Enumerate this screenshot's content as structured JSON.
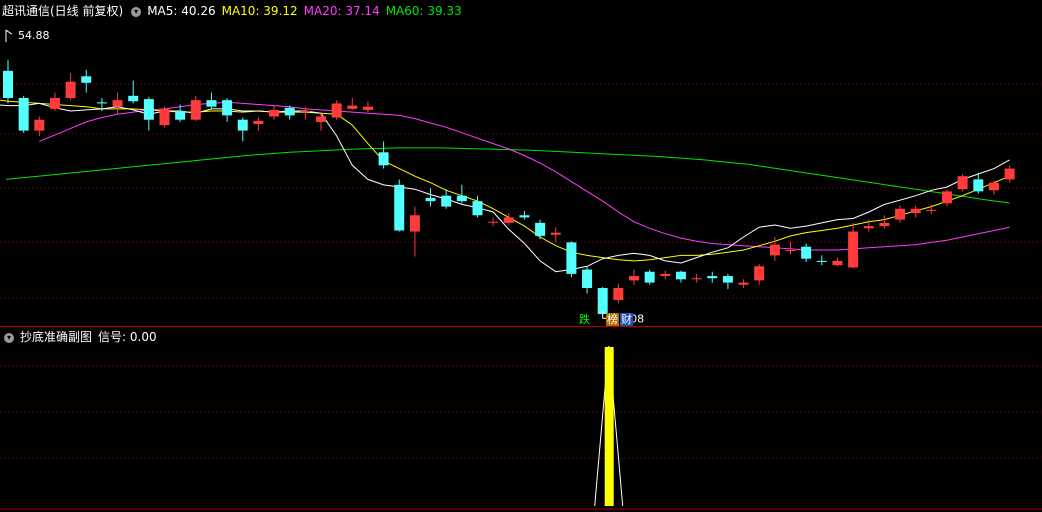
{
  "main_panel": {
    "title": "超讯通信(日线 前复权)",
    "ma_labels": [
      {
        "text": "MA5: 40.26",
        "color": "#ffffff"
      },
      {
        "text": "MA10: 39.12",
        "color": "#ffff00"
      },
      {
        "text": "MA20: 37.14",
        "color": "#ff3cff"
      },
      {
        "text": "MA60: 39.33",
        "color": "#00e600"
      }
    ],
    "high_label": "54.88",
    "low_label": "29.08",
    "tags": [
      {
        "text": "跌",
        "color": "#00ff00",
        "bg": "#000000"
      },
      {
        "text": "榜",
        "color": "#ffffff",
        "bg": "#b36b00"
      },
      {
        "text": "财",
        "color": "#ffffff",
        "bg": "#1f4fb0"
      }
    ]
  },
  "sub_panel": {
    "title": "抄底准确副图",
    "signal_label": "信号: 0.00"
  },
  "colors": {
    "up": "#ff3b3b",
    "down": "#54ffff",
    "ma5": "#ffffff",
    "ma10": "#ffff00",
    "ma20": "#ff3cff",
    "ma60": "#00e600",
    "signal": "#ffff00",
    "grid": "#8b0000"
  },
  "chart_data": [
    {
      "type": "candlestick",
      "ylim": [
        28,
        56
      ],
      "series": [
        {
          "name": "MA5",
          "values": [
            50,
            48.8,
            48.5,
            48.4,
            48.3,
            48.3,
            48.5,
            48.1,
            47.8,
            47.9,
            48.0,
            48.2,
            47.9,
            47.5,
            47.8,
            47.8,
            47.6,
            48.0,
            48.0,
            47.8,
            47.8,
            47.7,
            47.8,
            47.8,
            47.6,
            45.5,
            42.8,
            41.5,
            41.0,
            40.8,
            40.6,
            40.1,
            39.7,
            39.2,
            38.9,
            38.5,
            36.9,
            35.6,
            34.0,
            33.0,
            33.2,
            33.5,
            34.2,
            34.5,
            34.7,
            34.5,
            34.0,
            33.8,
            34.3,
            34.8,
            35.2,
            36.2,
            37.1,
            37.3,
            37.0,
            37.2,
            37.5,
            37.8,
            37.9,
            38.5,
            39.2,
            39.6,
            40.0,
            40.5,
            40.8,
            41.5,
            42.0,
            42.5,
            43.3
          ]
        },
        {
          "name": "MA10",
          "values": [
            49.0,
            48.9,
            48.7,
            48.6,
            48.5,
            48.4,
            48.3,
            48.2,
            48.0,
            48.0,
            48.0,
            47.9,
            47.8,
            47.7,
            47.7,
            47.8,
            47.8,
            47.7,
            47.8,
            47.7,
            47.7,
            47.7,
            47.6,
            47.5,
            46.5,
            44.8,
            43.2,
            42.5,
            41.8,
            41.2,
            40.5,
            40.0,
            39.5,
            38.8,
            38.0,
            37.2,
            36.2,
            35.4,
            34.8,
            34.5,
            34.3,
            34.1,
            34.0,
            34.1,
            34.3,
            34.5,
            34.5,
            34.6,
            34.8,
            35.0,
            35.4,
            35.8,
            36.3,
            36.6,
            36.8,
            37.0,
            37.3,
            37.6,
            37.8,
            38.2,
            38.6,
            39.0,
            39.5,
            40.0,
            40.6,
            41.2,
            41.8
          ]
        },
        {
          "name": "MA20",
          "values": [
            45.0,
            45.6,
            46.2,
            46.8,
            47.2,
            47.5,
            47.7,
            47.9,
            48.0,
            48.2,
            48.4,
            48.5,
            48.6,
            48.5,
            48.4,
            48.3,
            48.2,
            48.0,
            47.9,
            47.8,
            47.7,
            47.6,
            47.5,
            47.4,
            47.1,
            46.7,
            46.3,
            45.8,
            45.3,
            44.8,
            44.3,
            43.7,
            43.0,
            42.2,
            41.3,
            40.4,
            39.5,
            38.5,
            37.6,
            37.0,
            36.5,
            36.1,
            35.8,
            35.6,
            35.5,
            35.4,
            35.3,
            35.2,
            35.1,
            35.0,
            35.0,
            35.0,
            35.1,
            35.2,
            35.3,
            35.4,
            35.5,
            35.7,
            35.9,
            36.2,
            36.5,
            36.8,
            37.1
          ]
        },
        {
          "name": "MA60",
          "values": [
            41.5,
            41.7,
            41.9,
            42.1,
            42.3,
            42.5,
            42.7,
            42.9,
            43.1,
            43.3,
            43.5,
            43.7,
            43.85,
            44.0,
            44.1,
            44.2,
            44.3,
            44.35,
            44.4,
            44.4,
            44.4,
            44.35,
            44.3,
            44.25,
            44.2,
            44.1,
            44.0,
            43.9,
            43.8,
            43.7,
            43.6,
            43.45,
            43.3,
            43.1,
            42.9,
            42.6,
            42.3,
            42.0,
            41.7,
            41.4,
            41.1,
            40.8,
            40.5,
            40.2,
            39.9,
            39.6,
            39.33
          ]
        }
      ],
      "candles": [
        [
          51.5,
          49.0,
          52.5,
          48.5
        ],
        [
          49.0,
          46.0,
          49.2,
          45.8
        ],
        [
          46.0,
          47.0,
          47.3,
          45.5
        ],
        [
          48.0,
          49.0,
          49.5,
          47.8
        ],
        [
          49.0,
          50.5,
          51.3,
          48.8
        ],
        [
          51.0,
          50.4,
          51.6,
          49.5
        ],
        [
          48.6,
          48.5,
          49.0,
          47.8
        ],
        [
          48.2,
          48.8,
          49.5,
          47.5
        ],
        [
          49.2,
          48.7,
          50.6,
          48.5
        ],
        [
          48.9,
          47.0,
          49.1,
          46.0
        ],
        [
          46.5,
          48.0,
          48.2,
          46.3
        ],
        [
          47.8,
          47.0,
          48.4,
          46.8
        ],
        [
          47.0,
          48.8,
          49.2,
          46.9
        ],
        [
          48.8,
          48.2,
          49.5,
          48.0
        ],
        [
          48.8,
          47.4,
          49.0,
          46.8
        ],
        [
          47.0,
          46.0,
          47.2,
          45.0
        ],
        [
          46.6,
          46.9,
          47.2,
          46.0
        ],
        [
          47.3,
          47.9,
          48.3,
          47.0
        ],
        [
          48.1,
          47.4,
          48.3,
          47.0
        ],
        [
          47.8,
          47.8,
          48.2,
          47.0
        ],
        [
          46.8,
          47.3,
          47.6,
          46.0
        ],
        [
          47.2,
          48.5,
          48.8,
          47.0
        ],
        [
          48.0,
          48.3,
          49.0,
          47.9
        ],
        [
          47.9,
          48.2,
          48.7,
          47.7
        ],
        [
          44.0,
          42.8,
          45.0,
          42.5
        ],
        [
          41.0,
          36.8,
          41.5,
          36.7
        ],
        [
          36.7,
          38.2,
          39.0,
          34.4
        ],
        [
          39.8,
          39.5,
          40.7,
          39.0
        ],
        [
          40.0,
          39.0,
          40.6,
          38.8
        ],
        [
          40.0,
          39.5,
          41.0,
          39.3
        ],
        [
          39.5,
          38.2,
          40.0,
          38.0
        ],
        [
          37.6,
          37.6,
          38.0,
          37.2
        ],
        [
          37.5,
          38.0,
          38.4,
          37.3
        ],
        [
          38.2,
          38.0,
          38.6,
          37.8
        ],
        [
          37.5,
          36.3,
          37.8,
          36.0
        ],
        [
          36.4,
          36.6,
          37.1,
          35.7
        ],
        [
          35.7,
          32.8,
          35.8,
          32.5
        ],
        [
          33.2,
          31.5,
          33.5,
          31.0
        ],
        [
          31.5,
          29.1,
          31.6,
          29.08
        ],
        [
          30.4,
          31.5,
          31.9,
          30.1
        ],
        [
          32.2,
          32.6,
          33.2,
          31.8
        ],
        [
          33.0,
          32.0,
          33.2,
          31.8
        ],
        [
          32.6,
          32.8,
          33.1,
          32.3
        ],
        [
          33.0,
          32.3,
          33.1,
          32.0
        ],
        [
          32.3,
          32.4,
          32.8,
          32.0
        ],
        [
          32.6,
          32.4,
          33.0,
          32.0
        ],
        [
          32.6,
          32.0,
          32.8,
          31.4
        ],
        [
          31.8,
          32.0,
          32.3,
          31.5
        ],
        [
          32.2,
          33.5,
          33.7,
          31.8
        ],
        [
          34.5,
          35.5,
          36.2,
          34.0
        ],
        [
          35.0,
          35.0,
          35.8,
          34.6
        ],
        [
          35.3,
          34.2,
          35.6,
          33.9
        ],
        [
          34.0,
          33.9,
          34.5,
          33.6
        ],
        [
          33.6,
          34.0,
          34.3,
          33.5
        ],
        [
          33.4,
          36.7,
          37.5,
          33.3
        ],
        [
          37.0,
          37.2,
          37.8,
          36.7
        ],
        [
          37.2,
          37.5,
          38.2,
          37.0
        ],
        [
          37.8,
          38.8,
          39.1,
          37.5
        ],
        [
          38.4,
          38.8,
          39.1,
          38.0
        ],
        [
          38.6,
          38.7,
          39.2,
          38.3
        ],
        [
          39.3,
          40.4,
          40.6,
          39.0
        ],
        [
          40.6,
          41.8,
          42.0,
          40.4
        ],
        [
          41.5,
          40.4,
          42.1,
          40.2
        ],
        [
          40.5,
          41.2,
          41.4,
          40.1
        ],
        [
          41.5,
          42.5,
          42.8,
          41.2
        ]
      ]
    },
    {
      "type": "bar",
      "title": "抄底准确副图",
      "x_index": 38,
      "values": [
        1
      ],
      "ylim": [
        0,
        1
      ]
    }
  ]
}
